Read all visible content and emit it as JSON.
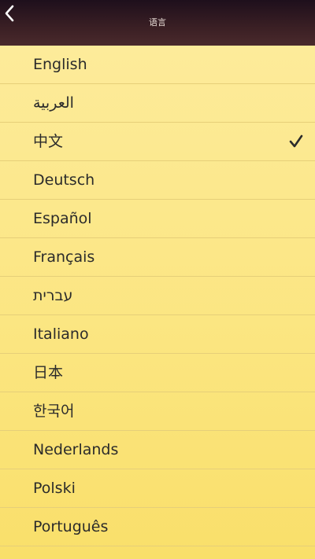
{
  "header": {
    "title": "语言"
  },
  "languages": [
    {
      "label": "English"
    },
    {
      "label": "العربية"
    },
    {
      "label": "中文",
      "selected": true
    },
    {
      "label": "Deutsch"
    },
    {
      "label": "Español"
    },
    {
      "label": "Français"
    },
    {
      "label": "עברית"
    },
    {
      "label": "Italiano"
    },
    {
      "label": "日本"
    },
    {
      "label": "한국어"
    },
    {
      "label": "Nederlands"
    },
    {
      "label": "Polski"
    },
    {
      "label": "Português"
    }
  ],
  "icons": {
    "back": "chevron-left-icon",
    "check": "checkmark-icon"
  },
  "colors": {
    "header": "#3a1f24",
    "list_background": "#fbe989",
    "text": "#2b2b2b"
  }
}
